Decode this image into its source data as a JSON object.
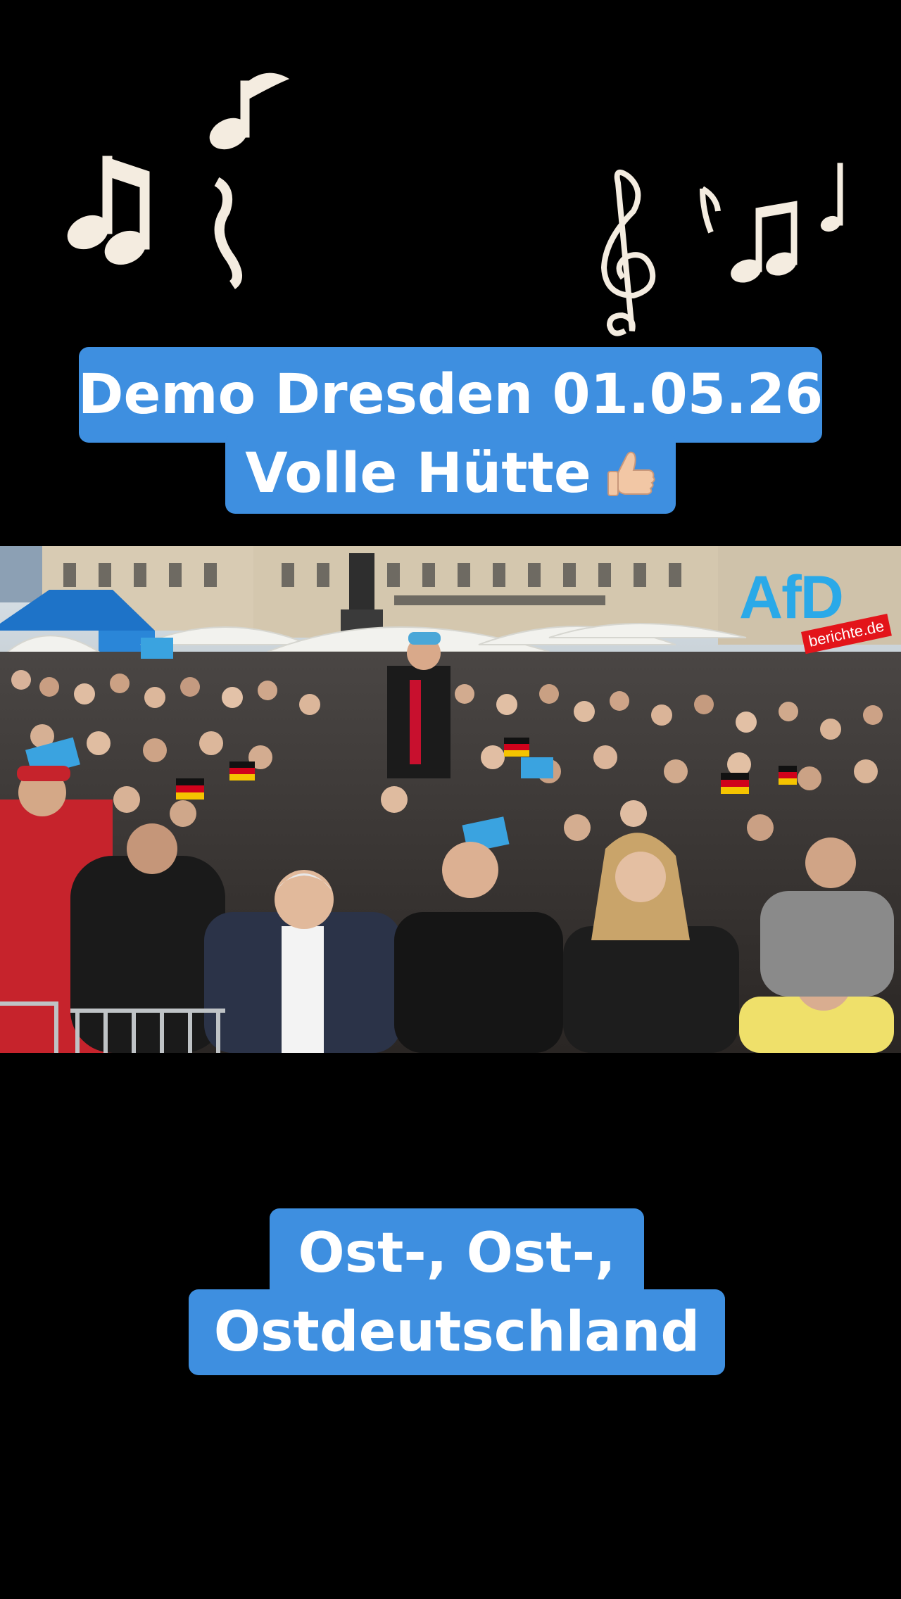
{
  "caption_top": {
    "line1": "Demo Dresden 01.05.26",
    "line2": "Volle Hütte"
  },
  "caption_bottom": {
    "line1": "Ost-, Ost-,",
    "line2": "Ostdeutschland"
  },
  "logo": {
    "brand": "AfD",
    "site": "berichte.de"
  },
  "colors": {
    "caption_bg": "#3e8fe0",
    "caption_text": "#ffffff",
    "background": "#000000",
    "logo_blue": "#2aa9e8",
    "logo_red": "#e3141a"
  },
  "icons": [
    "music-note-icon",
    "treble-clef-icon",
    "thumbs-up-icon"
  ]
}
